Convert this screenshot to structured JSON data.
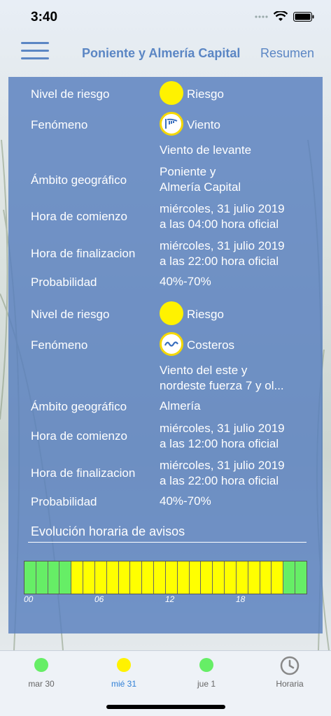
{
  "status_bar": {
    "time": "3:40"
  },
  "nav": {
    "title": "Poniente y Almería Capital",
    "action_label": "Resumen"
  },
  "warnings": [
    {
      "risk_label": "Nivel de riesgo",
      "risk_value": "Riesgo",
      "risk_color": "#fff200",
      "phenomenon_label": "Fenómeno",
      "phenomenon_value": "Viento",
      "phenomenon_icon": "wind-icon",
      "description": "Viento de levante",
      "area_label": "Ámbito geográfico",
      "area_value": "Poniente y\nAlmería Capital",
      "start_label": "Hora de comienzo",
      "start_value": "miércoles, 31 julio 2019\na las 04:00 hora oficial",
      "end_label": "Hora de finalizacion",
      "end_value": "miércoles, 31 julio 2019\na las 22:00 hora oficial",
      "prob_label": "Probabilidad",
      "prob_value": "40%-70%"
    },
    {
      "risk_label": "Nivel de riesgo",
      "risk_value": "Riesgo",
      "risk_color": "#fff200",
      "phenomenon_label": "Fenómeno",
      "phenomenon_value": "Costeros",
      "phenomenon_icon": "waves-icon",
      "description": "Viento del este y\nnordeste fuerza 7 y ol...",
      "area_label": "Ámbito geográfico",
      "area_value": "Almería",
      "start_label": "Hora de comienzo",
      "start_value": "miércoles, 31 julio 2019\na las 12:00 hora oficial",
      "end_label": "Hora de finalizacion",
      "end_value": "miércoles, 31 julio 2019\na las 22:00 hora oficial",
      "prob_label": "Probabilidad",
      "prob_value": "40%-70%"
    }
  ],
  "timeline": {
    "title": "Evolución horaria de avisos",
    "hours": [
      "green",
      "green",
      "green",
      "green",
      "yellow",
      "yellow",
      "yellow",
      "yellow",
      "yellow",
      "yellow",
      "yellow",
      "yellow",
      "yellow",
      "yellow",
      "yellow",
      "yellow",
      "yellow",
      "yellow",
      "yellow",
      "yellow",
      "yellow",
      "yellow",
      "green",
      "green"
    ],
    "colors": {
      "green": "#66ee66",
      "yellow": "#ffff00"
    },
    "ticks": [
      "00",
      "06",
      "12",
      "18"
    ]
  },
  "tabs": [
    {
      "label": "mar 30",
      "color": "#66ee66",
      "icon": "green-dot-icon",
      "active": false
    },
    {
      "label": "mié 31",
      "color": "#fff200",
      "icon": "yellow-dot-icon",
      "active": true
    },
    {
      "label": "jue 1",
      "color": "#66ee66",
      "icon": "green-dot-icon",
      "active": false
    },
    {
      "label": "Horaria",
      "color": "#888888",
      "icon": "clock-icon",
      "active": false
    }
  ]
}
